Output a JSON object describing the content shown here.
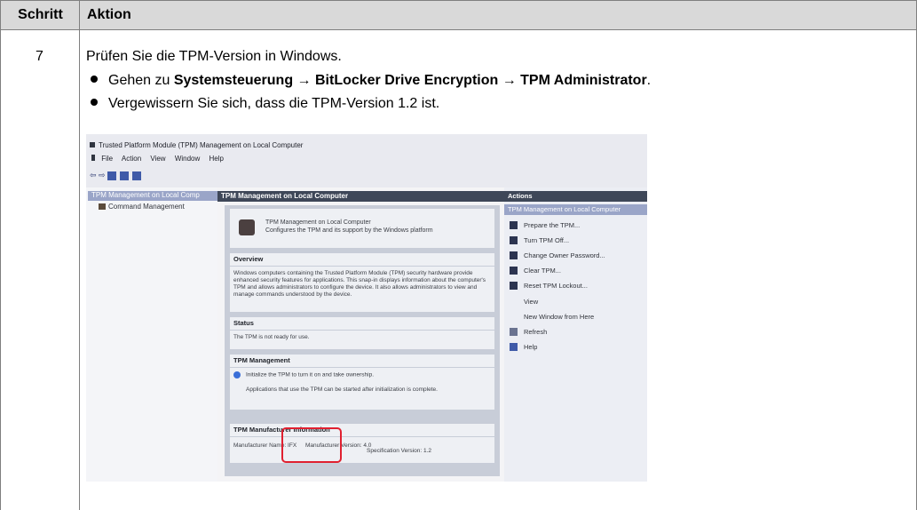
{
  "table": {
    "header": {
      "step": "Schritt",
      "action": "Aktion"
    },
    "row": {
      "step": "7",
      "intro": "Prüfen Sie die TPM-Version in Windows.",
      "bullet1": {
        "prefix": "Gehen zu ",
        "path": "Systemsteuerung → BitLocker Drive Encryption → TPM Administrator",
        "suffix": "."
      },
      "bullet2": "Vergewissern Sie sich, dass die TPM-Version 1.2 ist."
    }
  },
  "photo": {
    "window_title": "Trusted Platform Module (TPM) Management on Local Computer",
    "menu": [
      "File",
      "Action",
      "View",
      "Window",
      "Help"
    ],
    "tree": {
      "root": "TPM Management on Local Comp",
      "child": "Command Management"
    },
    "center": {
      "header": "TPM Management on Local Computer",
      "intro_title": "TPM Management on Local Computer",
      "intro_sub": "Configures the TPM and its support by the Windows platform",
      "overview_title": "Overview",
      "overview_text": "Windows computers containing the Trusted Platform Module (TPM) security hardware provide enhanced security features for applications. This snap-in displays information about the computer's TPM and allows administrators to configure the device. It also allows administrators to view and manage commands understood by the device.",
      "status_title": "Status",
      "status_text": "The TPM is not ready for use.",
      "mgmt_title": "TPM Management",
      "mgmt_text1": "Initialize the TPM to turn it on and take ownership.",
      "mgmt_text2": "Applications that use the TPM can be started after initialization is complete.",
      "mfr_title": "TPM Manufacturer Information",
      "mfr_name": "Manufacturer Name:  IFX",
      "mfr_version": "Manufacturer Version:  4.0",
      "spec_version": "Specification Version:  1.2"
    },
    "actions": {
      "header": "Actions",
      "subheader": "TPM Management on Local Computer",
      "items": [
        "Prepare the TPM...",
        "Turn TPM Off...",
        "Change Owner Password...",
        "Clear TPM...",
        "Reset TPM Lockout...",
        "View",
        "New Window from Here",
        "Refresh",
        "Help"
      ]
    }
  },
  "colors": {
    "header_bg": "#d9d9d9",
    "border": "#7f7f7f",
    "highlight_box": "#e02030"
  }
}
